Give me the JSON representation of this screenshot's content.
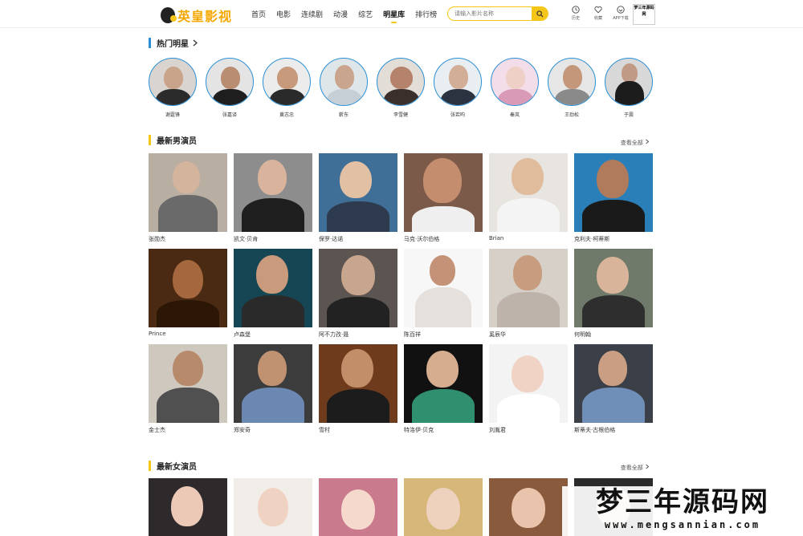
{
  "header": {
    "logo_text": "英皇影视",
    "nav": [
      "首页",
      "电影",
      "连续剧",
      "动漫",
      "综艺",
      "明星库",
      "排行榜"
    ],
    "active_nav": "明星库",
    "search_placeholder": "请输入影片名称",
    "tools": [
      {
        "label": "历史",
        "icon": "clock-icon"
      },
      {
        "label": "收藏",
        "icon": "heart-icon"
      },
      {
        "label": "APP下载",
        "icon": "phone-icon"
      }
    ],
    "qr_text": "梦三年源码网"
  },
  "hot_stars": {
    "title": "热门明星",
    "items": [
      "谢霆锋",
      "张嘉译",
      "黄志忠",
      "靳东",
      "李雪健",
      "张若昀",
      "秦岚",
      "王劲松",
      "于震"
    ]
  },
  "male_actors": {
    "title": "最新男演员",
    "more": "查看全部",
    "items": [
      "张勋杰",
      "凯文·贝肯",
      "保罗·达诺",
      "马克·沃尔伯格",
      "Brian",
      "克利夫·柯蒂斯",
      "Prince",
      "卢森堡",
      "阿不力孜·聂",
      "陈百祥",
      "奚辰华",
      "何明翰",
      "金士杰",
      "郑安奇",
      "雪村",
      "特洛伊·贝克",
      "刘胤君",
      "斯蒂夫·古根伯格"
    ]
  },
  "female_actors": {
    "title": "最新女演员",
    "more": "查看全部"
  },
  "watermark": {
    "big": "梦三年源码网",
    "url": "www.mengsannian.com"
  },
  "colors": {
    "accent": "#f5c518",
    "hot_bar": "#2a8fd6",
    "section_bar": "#f5c518"
  }
}
